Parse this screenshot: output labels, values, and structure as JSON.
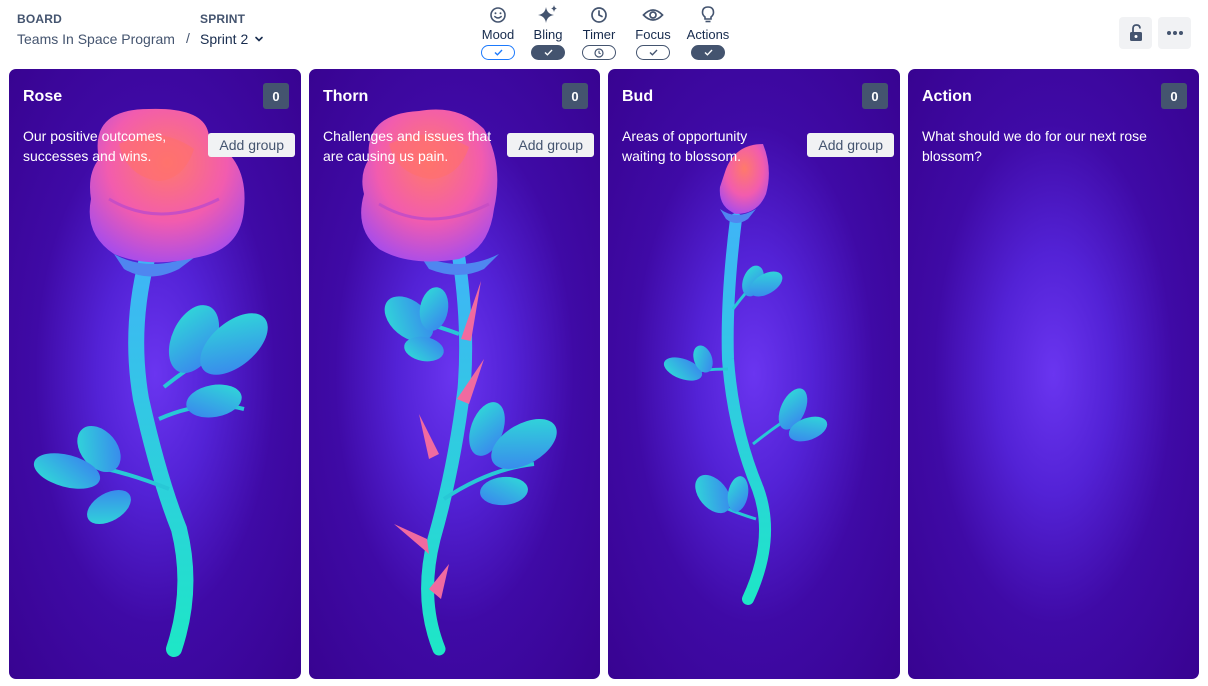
{
  "header": {
    "board_label": "BOARD",
    "board_name": "Teams In Space Program",
    "separator": "/",
    "sprint_label": "SPRINT",
    "sprint_value": "Sprint 2"
  },
  "tools": [
    {
      "label": "Mood",
      "icon": "smiley-icon",
      "state": "off"
    },
    {
      "label": "Bling",
      "icon": "sparkle-icon",
      "state": "on"
    },
    {
      "label": "Timer",
      "icon": "clock-icon",
      "state": "off"
    },
    {
      "label": "Focus",
      "icon": "eye-icon",
      "state": "off"
    },
    {
      "label": "Actions",
      "icon": "lightbulb-icon",
      "state": "on"
    }
  ],
  "columns": [
    {
      "title": "Rose",
      "count": "0",
      "description": "Our positive outcomes, successes and wins.",
      "add_label": "Add group"
    },
    {
      "title": "Thorn",
      "count": "0",
      "description": "Challenges and issues that are causing us pain.",
      "add_label": "Add group"
    },
    {
      "title": "Bud",
      "count": "0",
      "description": "Areas of opportunity waiting to blossom.",
      "add_label": "Add group"
    },
    {
      "title": "Action",
      "count": "0",
      "description": "What should we do for our next rose blossom?"
    }
  ],
  "colors": {
    "column_bg": "#3f0aa6",
    "stem": "#1fd6c8",
    "petal": "#f45ab0",
    "badge": "#44546f"
  }
}
